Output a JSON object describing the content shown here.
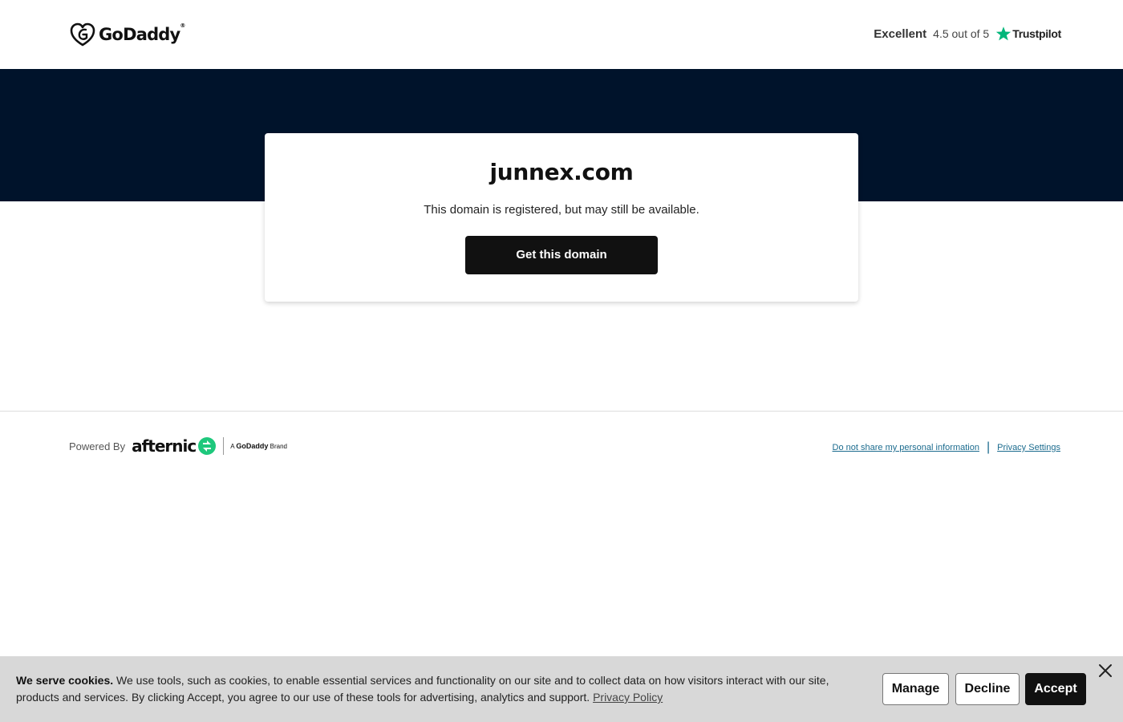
{
  "header": {
    "logo_text": "GoDaddy",
    "logo_tm": "®",
    "trustpilot": {
      "excellent_label": "Excellent",
      "rating_text": "4.5 out of 5",
      "brand": "Trustpilot",
      "star_color": "#00b67a"
    }
  },
  "colors": {
    "hero_background": "#00132b",
    "cta_background": "#111111",
    "afternic_green": "#1ec87c",
    "link_color": "#1b6b8e",
    "cookie_background": "#d8d8d8"
  },
  "card": {
    "domain": "junnex.com",
    "message": "This domain is registered, but may still be available.",
    "cta_label": "Get this domain"
  },
  "footer": {
    "powered_by": "Powered By",
    "afternic": "afternic",
    "brand_tag_prefix": "A",
    "brand_tag_name": "GoDaddy",
    "brand_tag_suffix": "Brand",
    "links": {
      "do_not_share": "Do not share my personal information",
      "privacy_settings": "Privacy Settings"
    }
  },
  "cookie_banner": {
    "heading": "We serve cookies.",
    "body": " We use tools, such as cookies, to enable essential services and functionality on our site and to collect data on how visitors interact with our site, products and services. By clicking Accept, you agree to our use of these tools for advertising, analytics and support. ",
    "privacy_link": "Privacy Policy",
    "manage_label": "Manage",
    "decline_label": "Decline",
    "accept_label": "Accept",
    "close_icon": "close-icon"
  }
}
